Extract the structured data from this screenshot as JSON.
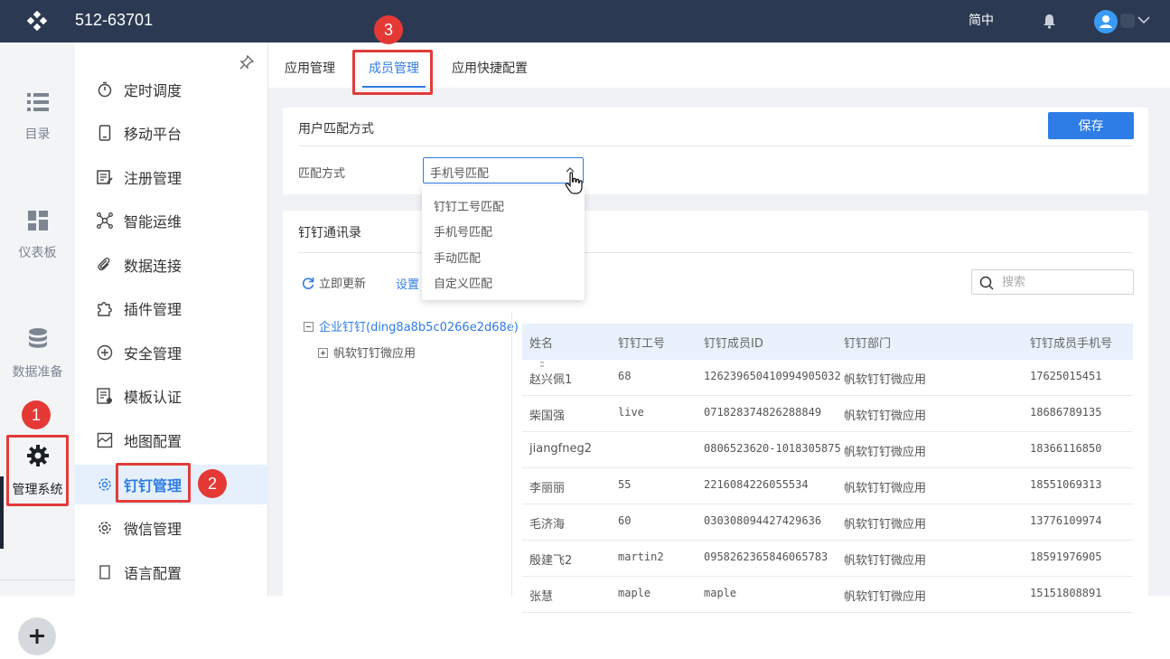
{
  "topbar": {
    "title": "512-63701",
    "lang_label": "简中"
  },
  "left_nav": [
    {
      "label": "目录",
      "icon": "list-icon"
    },
    {
      "label": "仪表板",
      "icon": "dashboard-icon"
    },
    {
      "label": "数据准备",
      "icon": "database-icon"
    },
    {
      "label": "管理系统",
      "icon": "gear-icon",
      "active": true
    }
  ],
  "annotations": {
    "badge1": "1",
    "badge2": "2",
    "badge3": "3"
  },
  "sidebar": {
    "items": [
      {
        "label": "定时调度",
        "icon": "timer-icon"
      },
      {
        "label": "移动平台",
        "icon": "mobile-icon"
      },
      {
        "label": "注册管理",
        "icon": "register-icon"
      },
      {
        "label": "智能运维",
        "icon": "network-icon"
      },
      {
        "label": "数据连接",
        "icon": "link-icon"
      },
      {
        "label": "插件管理",
        "icon": "puzzle-icon"
      },
      {
        "label": "安全管理",
        "icon": "shield-icon"
      },
      {
        "label": "模板认证",
        "icon": "template-icon"
      },
      {
        "label": "地图配置",
        "icon": "map-icon"
      },
      {
        "label": "钉钉管理",
        "icon": "dingtalk-gear-icon",
        "active": true
      },
      {
        "label": "微信管理",
        "icon": "wechat-gear-icon"
      },
      {
        "label": "语言配置",
        "icon": "language-icon"
      }
    ]
  },
  "tabs": [
    {
      "label": "应用管理"
    },
    {
      "label": "成员管理",
      "active": true
    },
    {
      "label": "应用快捷配置"
    }
  ],
  "user_match": {
    "title": "用户匹配方式",
    "save_label": "保存",
    "field_label": "匹配方式",
    "selected": "手机号匹配",
    "options": [
      "钉钉工号匹配",
      "手机号匹配",
      "手动匹配",
      "自定义匹配"
    ]
  },
  "contacts": {
    "title": "钉钉通讯录",
    "refresh_label": "立即更新",
    "settings_label": "设置",
    "search_placeholder": "搜索",
    "tree": {
      "root": "企业钉钉(ding8a8b5c0266e2d68e)",
      "child": "帆软钉钉微应用"
    },
    "columns": [
      "姓名",
      "钉钉工号",
      "钉钉成员ID",
      "钉钉部门",
      "钉钉成员手机号"
    ],
    "rows": [
      {
        "name": "赵兴佩1",
        "job_no": "68",
        "member_id": "126239650410994905032",
        "dept": "帆软钉钉微应用",
        "phone": "17625015451"
      },
      {
        "name": "柴国强",
        "job_no": "live",
        "member_id": "071828374826288849",
        "dept": "帆软钉钉微应用",
        "phone": "18686789135"
      },
      {
        "name": "jiangfneg2",
        "job_no": "",
        "member_id": "0806523620-1018305875",
        "dept": "帆软钉钉微应用",
        "phone": "18366116850"
      },
      {
        "name": "李丽丽",
        "job_no": "55",
        "member_id": "2216084226055534",
        "dept": "帆软钉钉微应用",
        "phone": "18551069313"
      },
      {
        "name": "毛济海",
        "job_no": "60",
        "member_id": "030308094427429636",
        "dept": "帆软钉钉微应用",
        "phone": "13776109974"
      },
      {
        "name": "殷建飞2",
        "job_no": "martin2",
        "member_id": "0958262365846065783",
        "dept": "帆软钉钉微应用",
        "phone": "18591976905"
      },
      {
        "name": "张慧",
        "job_no": "maple",
        "member_id": "maple",
        "dept": "帆软钉钉微应用",
        "phone": "15151808891"
      }
    ]
  },
  "colors": {
    "topbar": "#2b3a52",
    "accent": "#2e7ce6",
    "annotation": "#e53935"
  }
}
